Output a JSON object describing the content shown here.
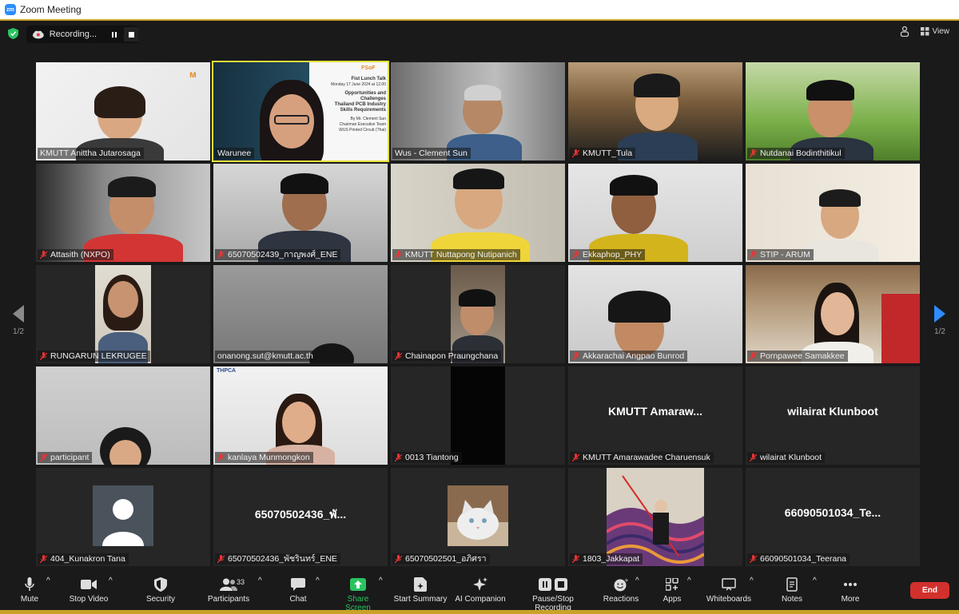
{
  "window": {
    "title": "Zoom Meeting",
    "logo_text": "zm"
  },
  "recording": {
    "label": "Recording..."
  },
  "topright": {
    "view_label": "View"
  },
  "pagination": {
    "left": "1/2",
    "right": "1/2"
  },
  "tiles": [
    {
      "name": "KMUTT Anittha Jutarosaga",
      "muted": false
    },
    {
      "name": "Warunee",
      "muted": false
    },
    {
      "name": "Wus - Clement Sun",
      "muted": false
    },
    {
      "name": "KMUTT_Tula",
      "muted": true
    },
    {
      "name": "Nutdanai Bodinthitikul",
      "muted": true
    },
    {
      "name": "Attasith (NXPO)",
      "muted": true
    },
    {
      "name": "65070502439_กาญพงศ์_ENE",
      "muted": true
    },
    {
      "name": "KMUTT Nuttapong Nutipanich",
      "muted": true
    },
    {
      "name": "Ekkaphop_PHY",
      "muted": true
    },
    {
      "name": "STIP - ARUM",
      "muted": true
    },
    {
      "name": "RUNGARUN LEKRUGEE",
      "muted": true
    },
    {
      "name": "onanong.sut@kmutt.ac.th",
      "muted": false
    },
    {
      "name": "Chainapon Praungchana",
      "muted": true
    },
    {
      "name": "Akkarachai Angpao Bunrod",
      "muted": true
    },
    {
      "name": "Pornpawee Samakkee",
      "muted": true
    },
    {
      "name": "participant",
      "muted": true
    },
    {
      "name": "kanlaya Munmongkon",
      "muted": true
    },
    {
      "name": "0013 Tiantong",
      "muted": true
    },
    {
      "name": "KMUTT Amarawadee Charuensuk",
      "muted": true,
      "big": "KMUTT  Amaraw..."
    },
    {
      "name": "wilairat Klunboot",
      "muted": true,
      "big": "wilairat Klunboot"
    },
    {
      "name": "404_Kunakron Tana",
      "muted": true
    },
    {
      "name": "65070502436_พัชรินทร์_ENE",
      "muted": true,
      "big": "65070502436_พั..."
    },
    {
      "name": "65070502501_อภิศรา",
      "muted": true
    },
    {
      "name": "1803_Jakkapat",
      "muted": true
    },
    {
      "name": "66090501034_Teerana",
      "muted": true,
      "big": "66090501034_Te..."
    }
  ],
  "slide": {
    "brand": "FSoF",
    "lines": [
      "Fist Lunch Talk",
      "Monday 17 June 2024 at 12.00",
      "Opportunities and Challenges",
      "Thailand PCB Industry",
      "Skills Requirements",
      "By Mr. Clement Sun",
      "Chairman Executive Team",
      "WUS Printed Circuit (Thai)"
    ]
  },
  "toolbar": {
    "mute": "Mute",
    "stop_video": "Stop Video",
    "security": "Security",
    "participants": "Participants",
    "participants_count": "33",
    "chat": "Chat",
    "share_screen": "Share Screen",
    "start_summary": "Start Summary",
    "ai_companion": "AI Companion",
    "pause_stop_recording": "Pause/Stop Recording",
    "reactions": "Reactions",
    "apps": "Apps",
    "whiteboards": "Whiteboards",
    "notes": "Notes",
    "more": "More",
    "end": "End"
  },
  "colors": {
    "accent": "#2d8cff",
    "share_green": "#29c35f",
    "end_red": "#d2302c",
    "active_border": "#e6e13a"
  }
}
